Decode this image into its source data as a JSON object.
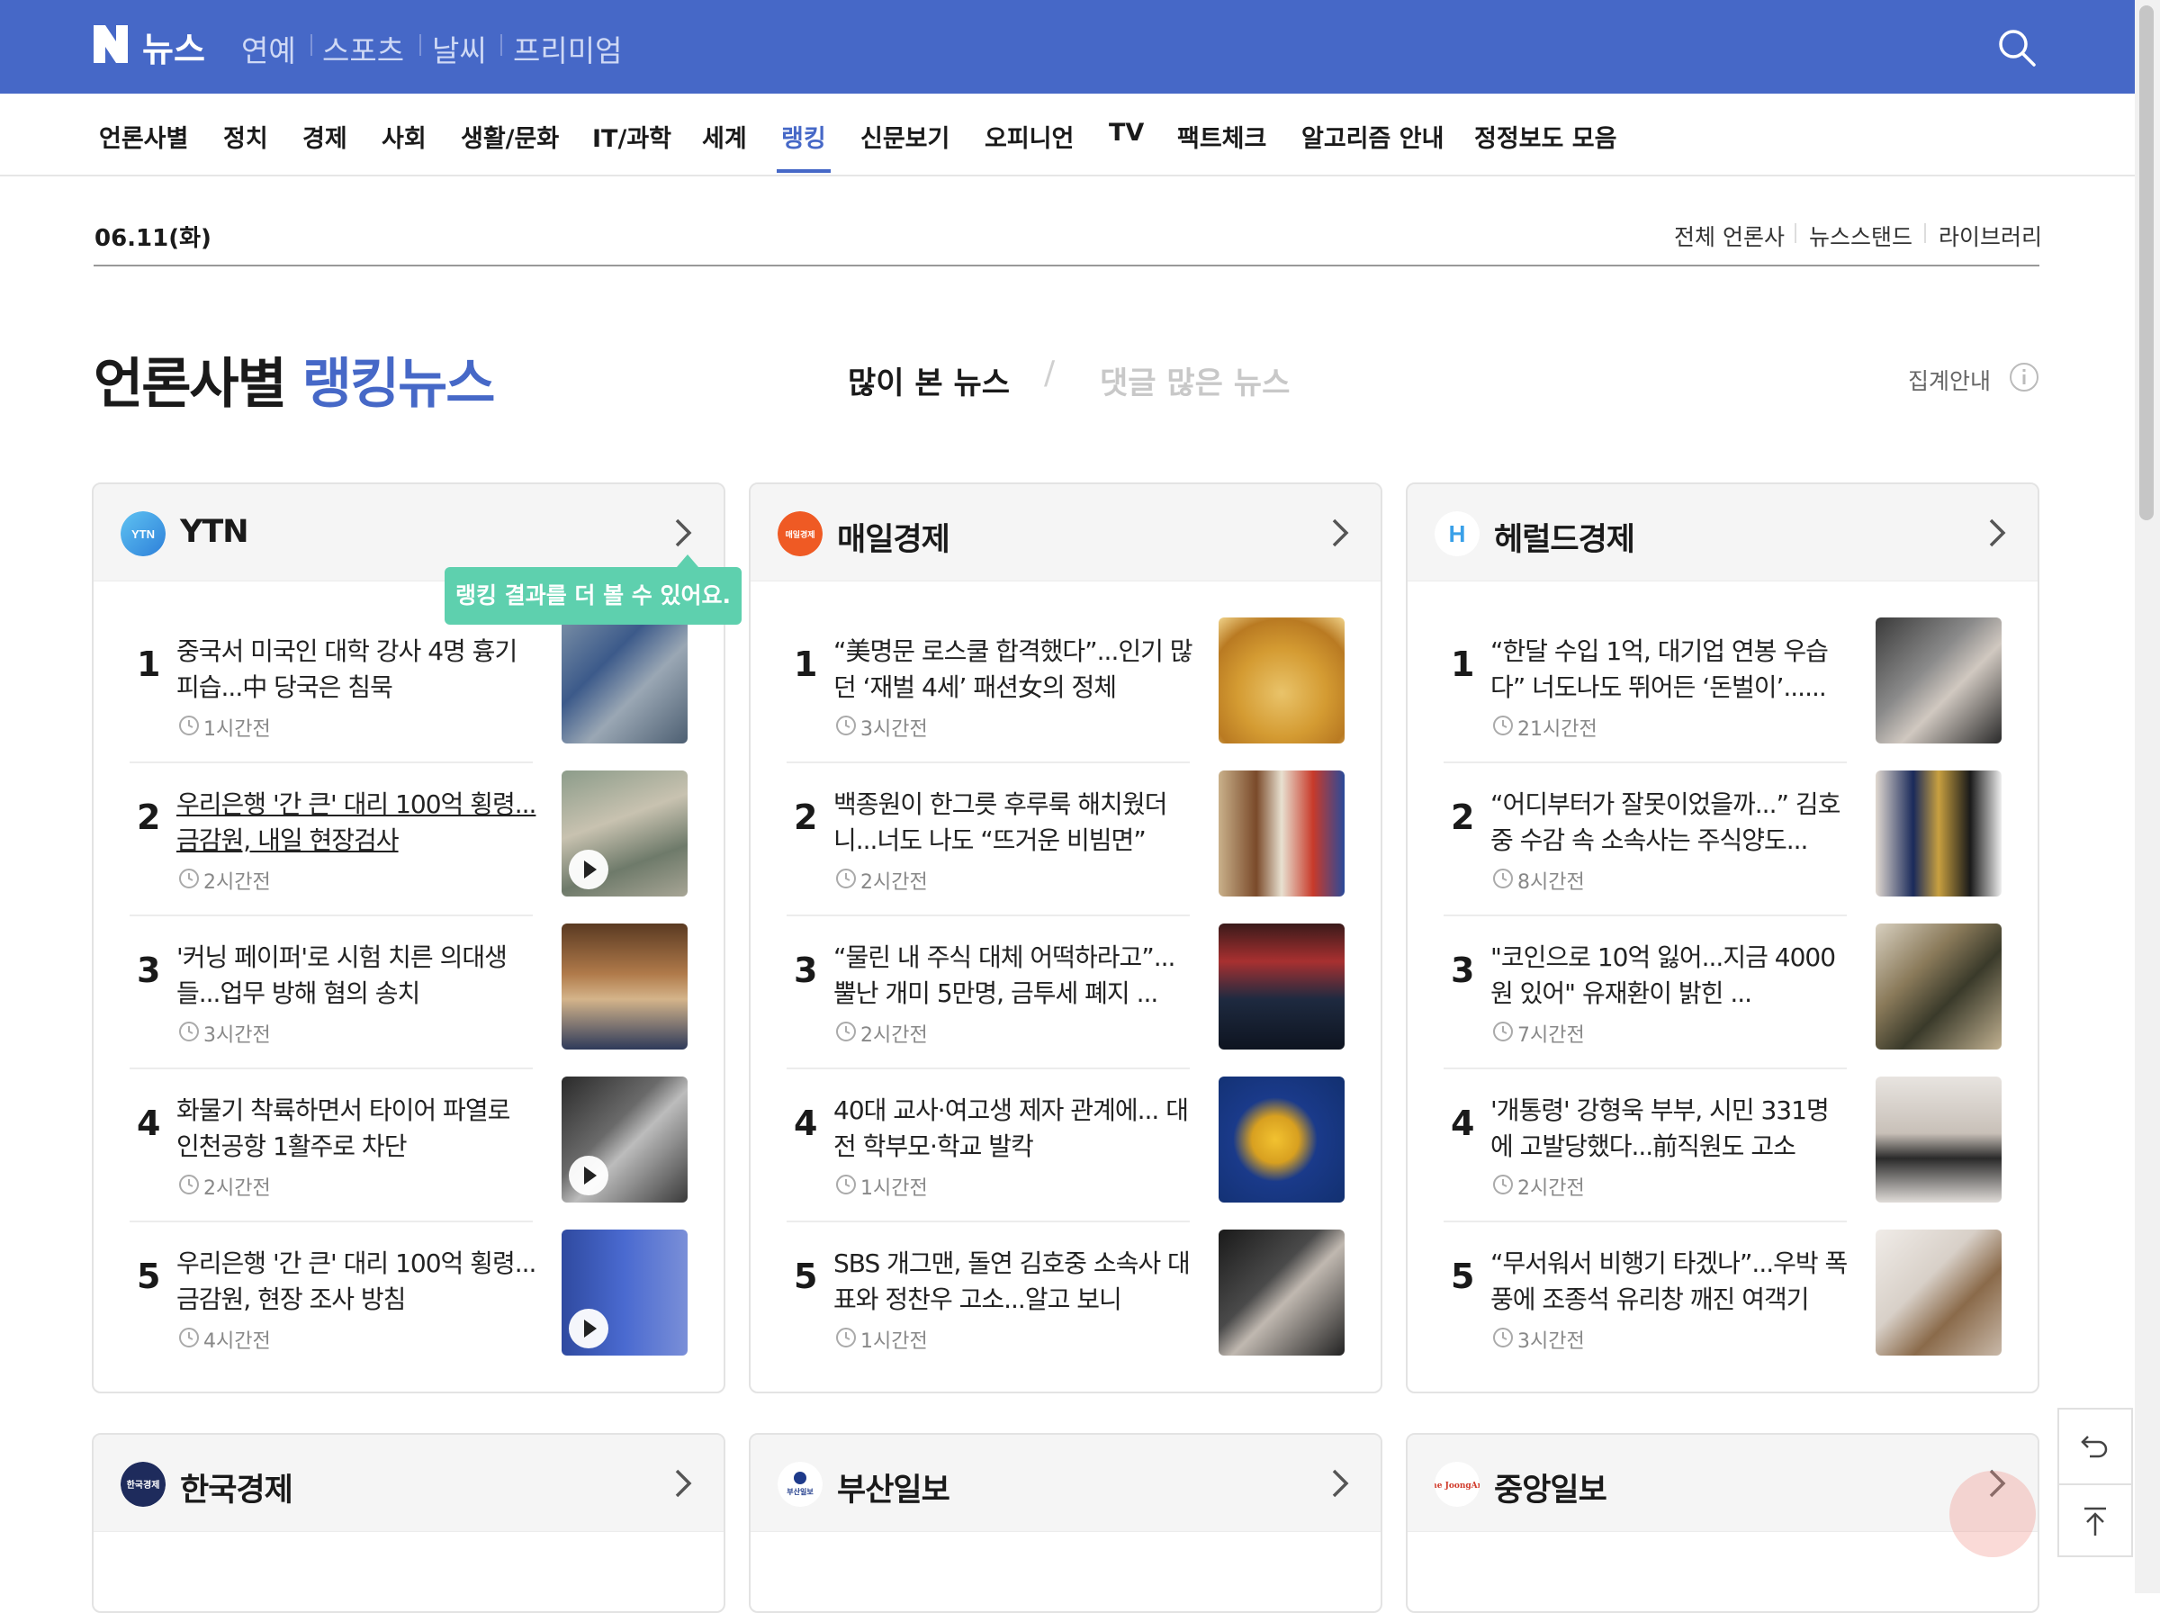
{
  "header": {
    "logo": "N",
    "site_name": "뉴스",
    "services": [
      "연예",
      "스포츠",
      "날씨",
      "프리미엄"
    ]
  },
  "nav": {
    "items": [
      "언론사별",
      "정치",
      "경제",
      "사회",
      "생활/문화",
      "IT/과학",
      "세계",
      "랭킹",
      "신문보기",
      "오피니언",
      "TV",
      "팩트체크",
      "알고리즘 안내",
      "정정보도 모음"
    ],
    "active": "랭킹"
  },
  "date": "06.11(화)",
  "top_links": [
    "전체 언론사",
    "뉴스스탠드",
    "라이브러리"
  ],
  "page": {
    "title_a": "언론사별",
    "title_b": "랭킹뉴스",
    "tab_most_viewed": "많이 본 뉴스",
    "tab_separator": "/",
    "tab_most_comments": "댓글 많은 뉴스",
    "aggregate_info": "집계안내"
  },
  "tooltip": "랭킹 결과를 더 볼 수 있어요.",
  "colors": {
    "brand": "#4668c7",
    "tooltip": "#5ed0ae"
  },
  "cards": [
    {
      "press": "YTN",
      "logo_text": "YTN",
      "logo_color": "#3aa0e8",
      "items": [
        {
          "rank": "1",
          "title": "중국서 미국인 대학 강사 4명 흉기 피습...中 당국은 침묵",
          "time": "1시간전",
          "video": false
        },
        {
          "rank": "2",
          "title": "우리은행 '간 큰' 대리 100억 횡령...금감원, 내일 현장검사",
          "time": "2시간전",
          "video": true
        },
        {
          "rank": "3",
          "title": "'커닝 페이퍼'로 시험 치른 의대생들...업무 방해 혐의 송치",
          "time": "3시간전",
          "video": false
        },
        {
          "rank": "4",
          "title": "화물기 착륙하면서 타이어 파열로 인천공항 1활주로 차단",
          "time": "2시간전",
          "video": true
        },
        {
          "rank": "5",
          "title": "우리은행 '간 큰' 대리 100억 횡령...금감원, 현장 조사 방침",
          "time": "4시간전",
          "video": true
        }
      ]
    },
    {
      "press": "매일경제",
      "logo_text": "매일경제",
      "logo_color": "#ef5a24",
      "items": [
        {
          "rank": "1",
          "title": "“美명문 로스쿨 합격했다”...인기 많던 ‘재벌 4세’ 패션女의 정체",
          "time": "3시간전",
          "video": false
        },
        {
          "rank": "2",
          "title": "백종원이 한그릇 후루룩 해치웠더니...너도 나도 “뜨거운 비빔면”",
          "time": "2시간전",
          "video": false
        },
        {
          "rank": "3",
          "title": "“물린 내 주식 대체 어떡하라고”... 뿔난 개미 5만명, 금투세 폐지 ...",
          "time": "2시간전",
          "video": false
        },
        {
          "rank": "4",
          "title": "40대 교사·여고생 제자 관계에... 대전 학부모·학교 발칵",
          "time": "1시간전",
          "video": false
        },
        {
          "rank": "5",
          "title": "SBS 개그맨, 돌연 김호중 소속사 대표와 정찬우 고소...알고 보니",
          "time": "1시간전",
          "video": false
        }
      ]
    },
    {
      "press": "헤럴드경제",
      "logo_text": "H",
      "logo_color": "#ffffff",
      "items": [
        {
          "rank": "1",
          "title": "“한달 수입 1억, 대기업 연봉 우습다” 너도나도 뛰어든 ‘돈벌이’......",
          "time": "21시간전",
          "video": false
        },
        {
          "rank": "2",
          "title": "“어디부터가 잘못이었을까...” 김호중 수감 속 소속사는 주식양도...",
          "time": "8시간전",
          "video": false
        },
        {
          "rank": "3",
          "title": "\"코인으로 10억 잃어...지금 4000원 있어\" 유재환이 밝힌 ...",
          "time": "7시간전",
          "video": false
        },
        {
          "rank": "4",
          "title": "'개통령' 강형욱 부부, 시민 331명에 고발당했다...前직원도 고소",
          "time": "2시간전",
          "video": false
        },
        {
          "rank": "5",
          "title": "“무서워서 비행기 타겠나”...우박 폭풍에 조종석 유리창 깨진 여객기",
          "time": "3시간전",
          "video": false
        }
      ]
    }
  ],
  "bottom_cards": [
    {
      "press": "한국경제",
      "logo_text": "한국경제",
      "logo_color": "#1e2b5c"
    },
    {
      "press": "부산일보",
      "logo_text": "부산일보",
      "logo_color": "#ffffff"
    },
    {
      "press": "중앙일보",
      "logo_text": "The JoongAng",
      "logo_color": "#ffffff"
    }
  ],
  "side_buttons": [
    "back-icon",
    "scroll-top-icon"
  ]
}
